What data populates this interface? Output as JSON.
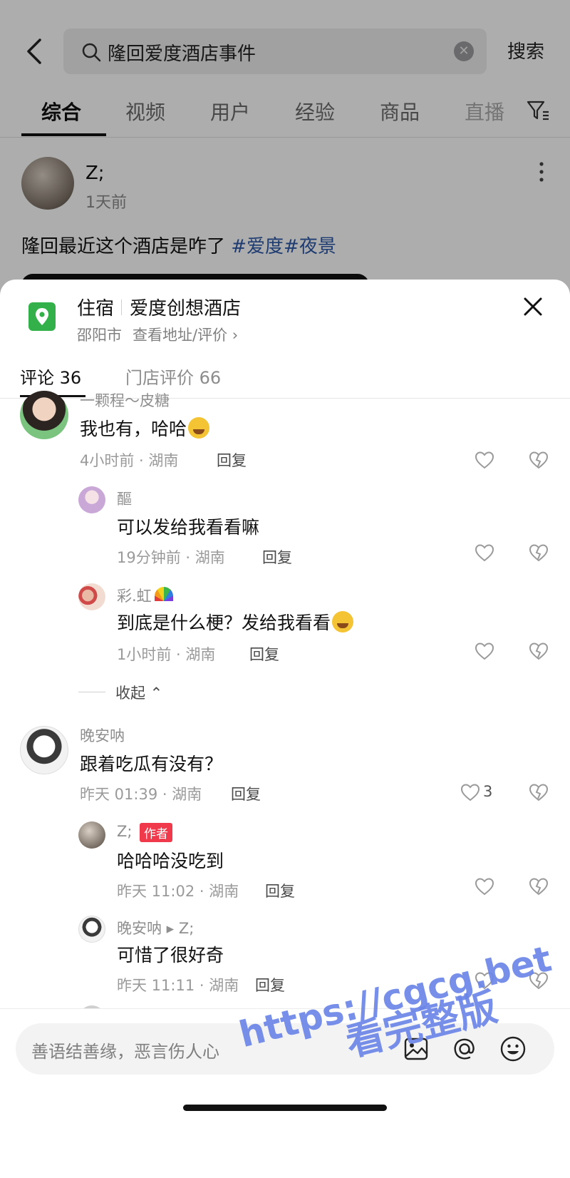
{
  "search": {
    "query": "隆回爱度酒店事件",
    "button_label": "搜索"
  },
  "tabs": [
    "综合",
    "视频",
    "用户",
    "经验",
    "商品",
    "直播"
  ],
  "post": {
    "author": "Z;",
    "time": "1天前",
    "text": "隆回最近这个酒店是咋了 ",
    "tags": "#爱度#夜景"
  },
  "sheet": {
    "category": "住宿",
    "hotel_name": "爱度创想酒店",
    "city": "邵阳市",
    "address_link": "查看地址/评价",
    "tabs": [
      "评论 36",
      "门店评价 66"
    ]
  },
  "comments": [
    {
      "name": "一颗程～皮糖",
      "text": "我也有，哈哈",
      "meta": "4小时前 · 湖南",
      "reply": "回复",
      "likes": ""
    },
    {
      "name": "醧",
      "text": "可以发给我看看嘛",
      "meta": "19分钟前 · 湖南",
      "reply": "回复",
      "likes": ""
    },
    {
      "name": "彩.虹",
      "text": "到底是什么梗？发给我看看",
      "meta": "1小时前 · 湖南",
      "reply": "回复",
      "likes": ""
    },
    {
      "name": "晚安呐",
      "text": "跟着吃瓜有没有？",
      "meta": "昨天 01:39 · 湖南",
      "reply": "回复",
      "likes": "3"
    },
    {
      "name": "Z;",
      "text": "哈哈哈没吃到",
      "meta": "昨天 11:02 · 湖南",
      "reply": "回复",
      "likes": ""
    },
    {
      "name": "晚安呐 ▸ Z;",
      "text": "可惜了很好奇",
      "meta": "昨天 11:11 · 湖南",
      "reply": "回复",
      "likes": ""
    }
  ],
  "collapse_label": "收起",
  "author_badge": "作者",
  "input_placeholder": "善语结善缘，恶言伤人心",
  "watermark": {
    "line1": "https://cgcg.bet",
    "line2": "看完整版"
  },
  "colors": {
    "accent_green": "#34b04a",
    "tag_blue": "#2d59a8",
    "badge_red": "#f03a4b",
    "watermark_blue": "#6c86e8"
  }
}
